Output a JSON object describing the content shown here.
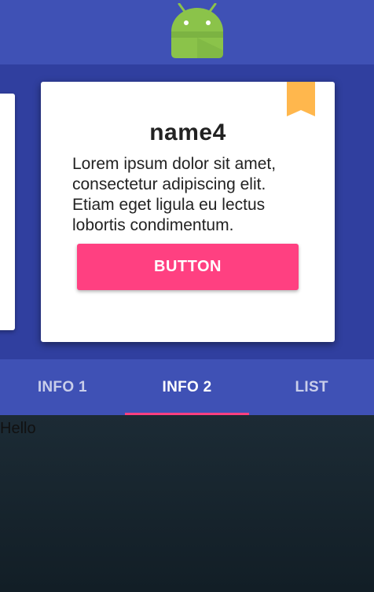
{
  "toolbar": {
    "logo_icon": "android-robot-icon",
    "color": "#3f51b5"
  },
  "card": {
    "title": "name4",
    "body": "Lorem ipsum dolor sit amet, consectetur adipiscing elit. Etiam eget ligula eu lectus lobortis condimentum.",
    "button_label": "BUTTON",
    "bookmark_icon": "bookmark-icon",
    "bookmark_color": "#ffb74d",
    "button_color": "#ff4081"
  },
  "tabs": [
    {
      "label": "INFO 1",
      "active": false
    },
    {
      "label": "INFO 2",
      "active": true
    },
    {
      "label": "LIST",
      "active": false
    }
  ],
  "content": {
    "text": "Hello"
  }
}
